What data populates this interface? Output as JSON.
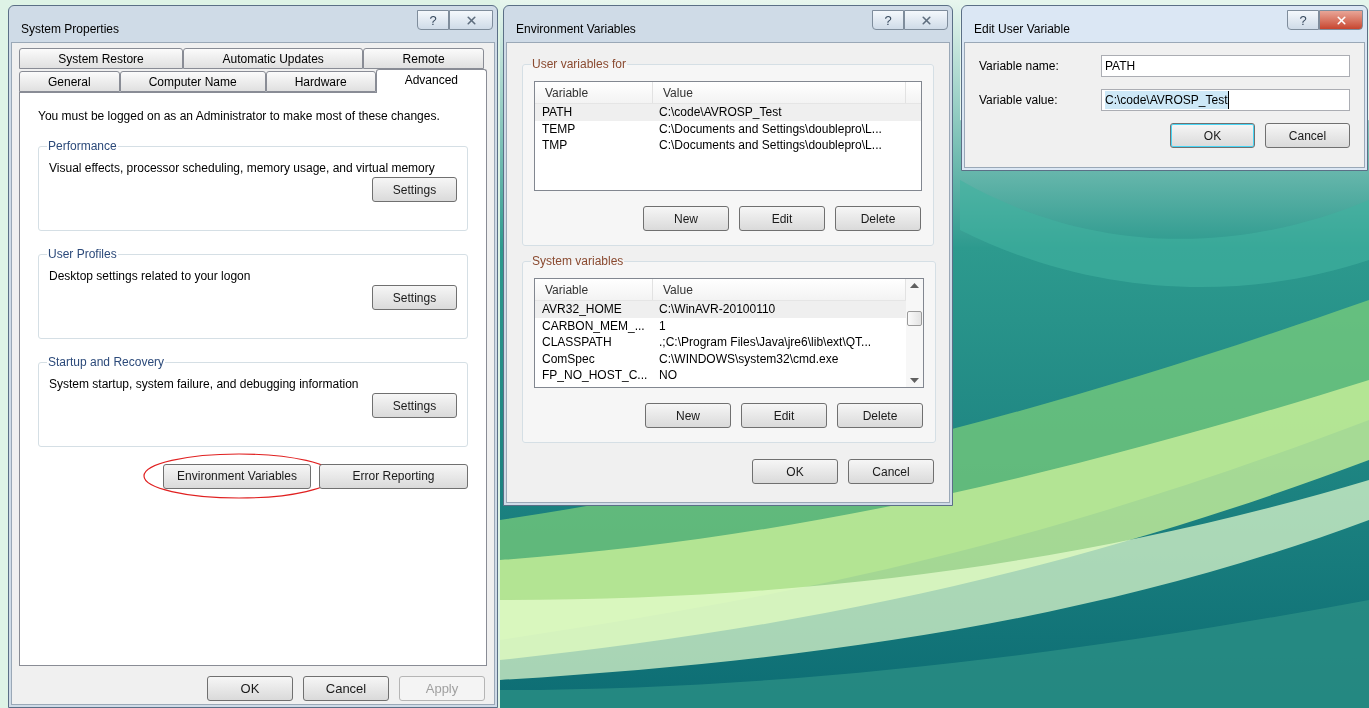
{
  "system_properties": {
    "title": "System Properties",
    "active": false,
    "help": "?",
    "tab_rows": [
      [
        {
          "label": "System Restore",
          "selected": false
        },
        {
          "label": "Automatic Updates",
          "selected": false
        },
        {
          "label": "Remote",
          "selected": false
        }
      ],
      [
        {
          "label": "General",
          "selected": false
        },
        {
          "label": "Computer Name",
          "selected": false
        },
        {
          "label": "Hardware",
          "selected": false
        },
        {
          "label": "Advanced",
          "selected": true
        }
      ]
    ],
    "notice": "You must be logged on as an Administrator to make most of these changes.",
    "groups": [
      {
        "title": "Performance",
        "description": "Visual effects, processor scheduling, memory usage, and virtual memory",
        "button": "Settings"
      },
      {
        "title": "User Profiles",
        "description": "Desktop settings related to your logon",
        "button": "Settings"
      },
      {
        "title": "Startup and Recovery",
        "description": "System startup, system failure, and debugging information",
        "button": "Settings"
      }
    ],
    "buttons": [
      {
        "label": "Environment Variables",
        "circled": true
      },
      {
        "label": "Error Reporting",
        "circled": false
      }
    ],
    "footer": [
      {
        "label": "OK",
        "disabled": false
      },
      {
        "label": "Cancel",
        "disabled": false
      },
      {
        "label": "Apply",
        "disabled": true
      }
    ]
  },
  "environment_variables": {
    "title": "Environment Variables",
    "active": false,
    "help": "?",
    "sections": [
      {
        "title": "User variables for",
        "columns": [
          "Variable",
          "Value"
        ],
        "scrollable": false,
        "rows": [
          {
            "cells": [
              "PATH",
              "C:\\code\\AVROSP_Test"
            ],
            "selected": true
          },
          {
            "cells": [
              "TEMP",
              "C:\\Documents and Settings\\doublepro\\L..."
            ],
            "selected": false
          },
          {
            "cells": [
              "TMP",
              "C:\\Documents and Settings\\doublepro\\L..."
            ],
            "selected": false
          }
        ],
        "buttons": [
          "New",
          "Edit",
          "Delete"
        ]
      },
      {
        "title": "System variables",
        "columns": [
          "Variable",
          "Value"
        ],
        "scrollable": true,
        "rows": [
          {
            "cells": [
              "AVR32_HOME",
              "C:\\WinAVR-20100110"
            ],
            "selected": true
          },
          {
            "cells": [
              "CARBON_MEM_...",
              "1"
            ],
            "selected": false
          },
          {
            "cells": [
              "CLASSPATH",
              ".;C:\\Program Files\\Java\\jre6\\lib\\ext\\QT..."
            ],
            "selected": false
          },
          {
            "cells": [
              "ComSpec",
              "C:\\WINDOWS\\system32\\cmd.exe"
            ],
            "selected": false
          },
          {
            "cells": [
              "FP_NO_HOST_C...",
              "NO"
            ],
            "selected": false
          }
        ],
        "buttons": [
          "New",
          "Edit",
          "Delete"
        ]
      }
    ],
    "footer": [
      {
        "label": "OK",
        "default": false
      },
      {
        "label": "Cancel",
        "default": false
      }
    ]
  },
  "edit_user_variable": {
    "title": "Edit User Variable",
    "active": true,
    "help": "?",
    "fields": [
      {
        "label": "Variable name:",
        "value": "PATH",
        "focused": false
      },
      {
        "label": "Variable value:",
        "value": "C:\\code\\AVROSP_Test",
        "focused": true
      }
    ],
    "footer": [
      {
        "label": "OK",
        "default": true
      },
      {
        "label": "Cancel",
        "default": false
      }
    ]
  }
}
